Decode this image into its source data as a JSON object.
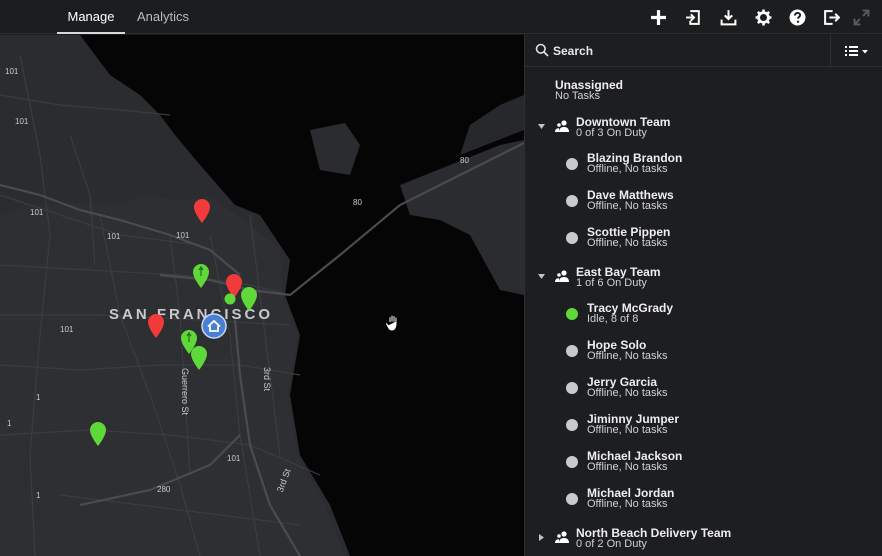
{
  "tabs": [
    {
      "label": "Manage",
      "active": true
    },
    {
      "label": "Analytics",
      "active": false
    }
  ],
  "toolbar": [
    {
      "name": "add-icon"
    },
    {
      "name": "import-icon"
    },
    {
      "name": "download-icon"
    },
    {
      "name": "gear-icon"
    },
    {
      "name": "help-icon"
    },
    {
      "name": "logout-icon"
    },
    {
      "name": "expand-icon"
    }
  ],
  "map": {
    "city": "SAN FRANCISCO",
    "road_labels": [
      "101",
      "101",
      "101",
      "101",
      "101",
      "101",
      "101",
      "80",
      "80",
      "280",
      "1",
      "1",
      "1"
    ],
    "streets": [
      "3rd St",
      "Guerrero St",
      "3rd St"
    ],
    "pin_colors": {
      "red": "#f23a3a",
      "green": "#5fd83a",
      "home": "#4a7fd6"
    }
  },
  "sidebar": {
    "search_placeholder": "Search",
    "unassigned": {
      "name": "Unassigned",
      "status": "No Tasks"
    },
    "teams": [
      {
        "name": "Downtown Team",
        "status": "0 of 3 On Duty",
        "expanded": true,
        "workers": [
          {
            "name": "Blazing Brandon",
            "status": "Offline, No tasks",
            "idle": false
          },
          {
            "name": "Dave Matthews",
            "status": "Offline, No tasks",
            "idle": false
          },
          {
            "name": "Scottie Pippen",
            "status": "Offline, No tasks",
            "idle": false
          }
        ]
      },
      {
        "name": "East Bay Team",
        "status": "1 of 6 On Duty",
        "expanded": true,
        "workers": [
          {
            "name": "Tracy McGrady",
            "status": "Idle, 8 of 8",
            "idle": true
          },
          {
            "name": "Hope Solo",
            "status": "Offline, No tasks",
            "idle": false
          },
          {
            "name": "Jerry Garcia",
            "status": "Offline, No tasks",
            "idle": false
          },
          {
            "name": "Jiminny Jumper",
            "status": "Offline, No tasks",
            "idle": false
          },
          {
            "name": "Michael Jackson",
            "status": "Offline, No tasks",
            "idle": false
          },
          {
            "name": "Michael Jordan",
            "status": "Offline, No tasks",
            "idle": false
          }
        ]
      },
      {
        "name": "North Beach Delivery Team",
        "status": "0 of 2 On Duty",
        "expanded": false,
        "workers": []
      }
    ]
  }
}
